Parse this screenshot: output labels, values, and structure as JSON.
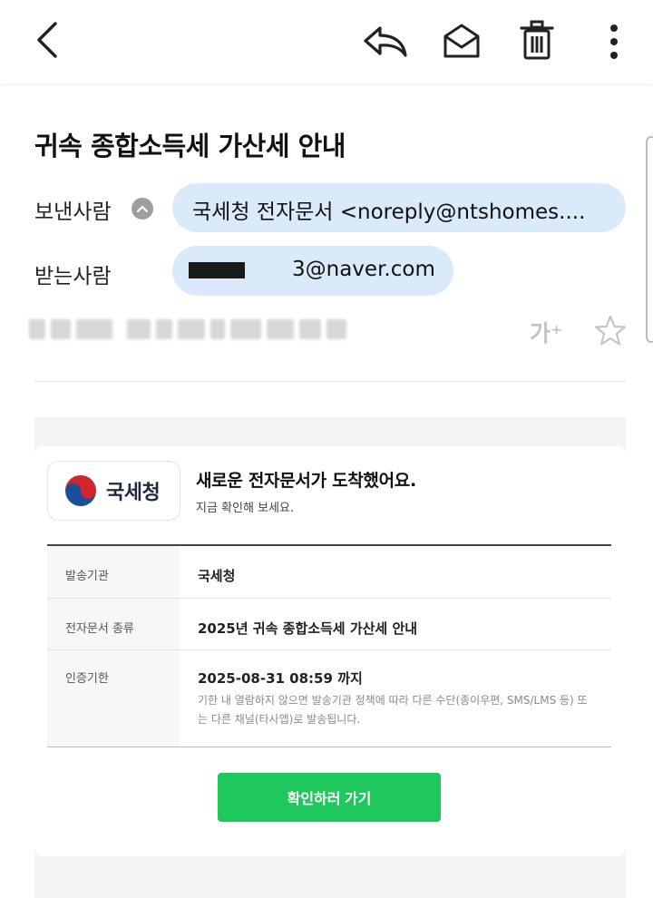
{
  "appbar": {
    "icons": [
      "back-arrow-icon",
      "reply-icon",
      "mark-unread-icon",
      "trash-icon",
      "more-vertical-icon"
    ]
  },
  "mail": {
    "subject": "귀속 종합소득세 가산세 안내",
    "from_label": "보낸사람",
    "from_value": "국세청 전자문서 <noreply@ntshomes....",
    "to_label": "받는사람",
    "to_value": "3@naver.com",
    "font_size_icon_text": "가⁺"
  },
  "content": {
    "logo_text": "국세청",
    "headline": "새로운 전자문서가 도착했어요.",
    "subline": "지금 확인해 보세요.",
    "rows": [
      {
        "key": "발송기관",
        "value": "국세청"
      },
      {
        "key": "전자문서 종류",
        "value": "2025년 귀속 종합소득세 가산세 안내"
      },
      {
        "key": "인증기한",
        "value": "2025-08-31 08:59 까지",
        "note": "기한 내 열람하지 않으면 발송기관 정책에 따라 다른 수단(종이우편, SMS/LMS 등) 또는 다른 채널(타사앱)로 발송됩니다."
      }
    ],
    "button_label": "확인하러 가기"
  },
  "colors": {
    "pill_bg": "#dbeafb",
    "cta_green": "#1fc85c",
    "logo_red": "#d4252d",
    "logo_blue": "#1c4e9c"
  }
}
